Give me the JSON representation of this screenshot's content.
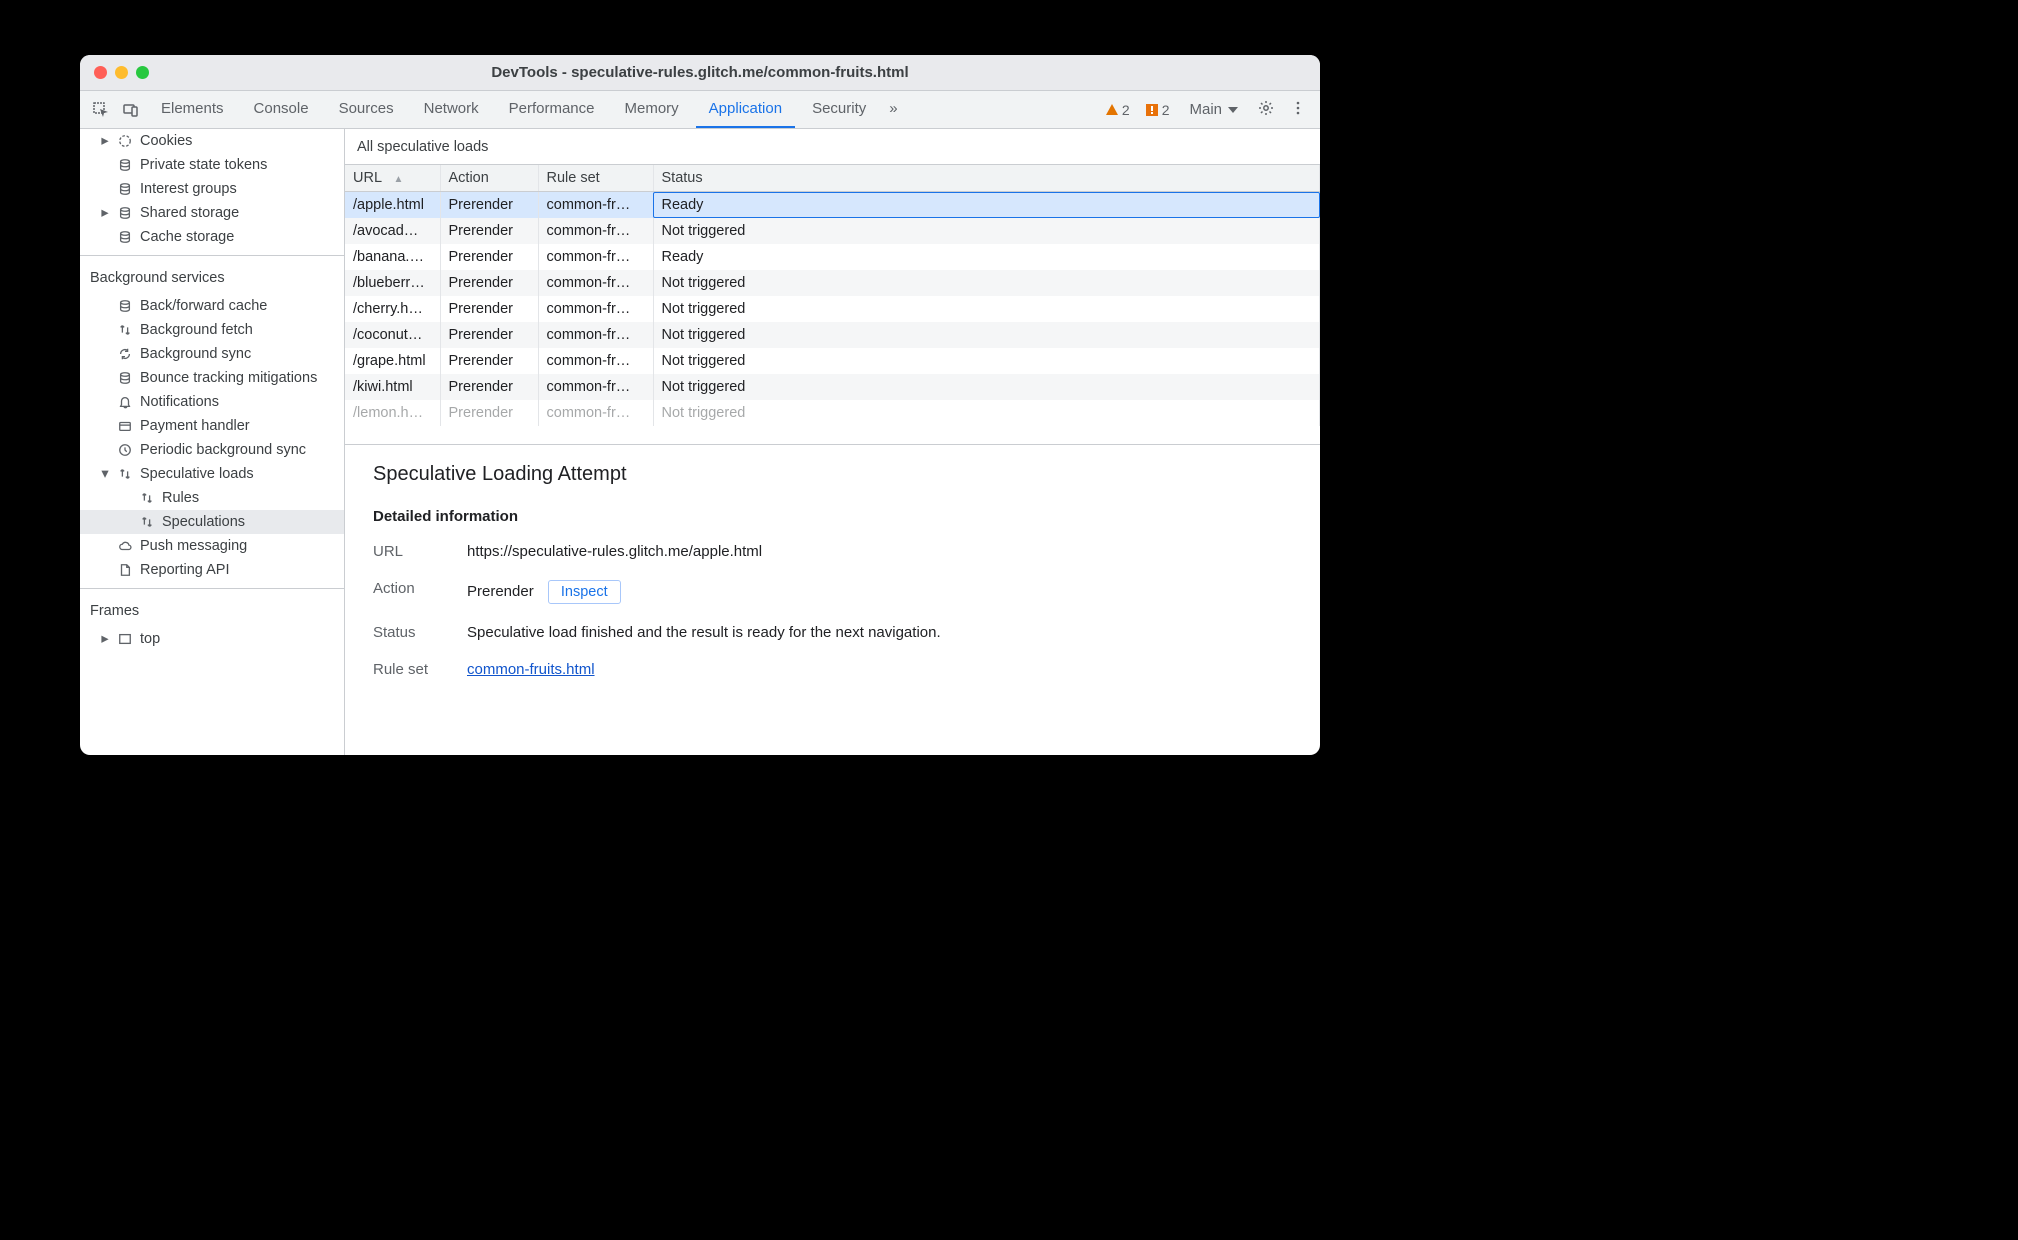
{
  "window": {
    "title": "DevTools - speculative-rules.glitch.me/common-fruits.html"
  },
  "tabs": {
    "items": [
      "Elements",
      "Console",
      "Sources",
      "Network",
      "Performance",
      "Memory",
      "Application",
      "Security"
    ],
    "active": "Application",
    "overflow": "»",
    "warnings_count": "2",
    "issues_count": "2",
    "context": "Main"
  },
  "sidebar": {
    "storage": [
      {
        "label": "Cookies",
        "icon": "cookie",
        "arrow": "collapsed",
        "indent": 1
      },
      {
        "label": "Private state tokens",
        "icon": "db",
        "arrow": "none",
        "indent": 1
      },
      {
        "label": "Interest groups",
        "icon": "db",
        "arrow": "none",
        "indent": 1
      },
      {
        "label": "Shared storage",
        "icon": "db",
        "arrow": "collapsed",
        "indent": 1
      },
      {
        "label": "Cache storage",
        "icon": "db",
        "arrow": "none",
        "indent": 1
      }
    ],
    "bg_title": "Background services",
    "bg": [
      {
        "label": "Back/forward cache",
        "icon": "db",
        "indent": 1
      },
      {
        "label": "Background fetch",
        "icon": "updown",
        "indent": 1
      },
      {
        "label": "Background sync",
        "icon": "sync",
        "indent": 1
      },
      {
        "label": "Bounce tracking mitigations",
        "icon": "db",
        "indent": 1
      },
      {
        "label": "Notifications",
        "icon": "bell",
        "indent": 1
      },
      {
        "label": "Payment handler",
        "icon": "card",
        "indent": 1
      },
      {
        "label": "Periodic background sync",
        "icon": "clock",
        "indent": 1
      }
    ],
    "specloads_label": "Speculative loads",
    "rules_label": "Rules",
    "speculations_label": "Speculations",
    "push_label": "Push messaging",
    "reporting_label": "Reporting API",
    "frames_title": "Frames",
    "frames_top": "top"
  },
  "filter": {
    "label": "All speculative loads"
  },
  "grid": {
    "columns": [
      "URL",
      "Action",
      "Rule set",
      "Status"
    ],
    "rows": [
      {
        "url": "/apple.html",
        "action": "Prerender",
        "ruleset": "common-fr…",
        "status": "Ready",
        "selected": true
      },
      {
        "url": "/avocad…",
        "action": "Prerender",
        "ruleset": "common-fr…",
        "status": "Not triggered"
      },
      {
        "url": "/banana.…",
        "action": "Prerender",
        "ruleset": "common-fr…",
        "status": "Ready"
      },
      {
        "url": "/blueberr…",
        "action": "Prerender",
        "ruleset": "common-fr…",
        "status": "Not triggered"
      },
      {
        "url": "/cherry.h…",
        "action": "Prerender",
        "ruleset": "common-fr…",
        "status": "Not triggered"
      },
      {
        "url": "/coconut…",
        "action": "Prerender",
        "ruleset": "common-fr…",
        "status": "Not triggered"
      },
      {
        "url": "/grape.html",
        "action": "Prerender",
        "ruleset": "common-fr…",
        "status": "Not triggered"
      },
      {
        "url": "/kiwi.html",
        "action": "Prerender",
        "ruleset": "common-fr…",
        "status": "Not triggered"
      },
      {
        "url": "/lemon.h…",
        "action": "Prerender",
        "ruleset": "common-fr…",
        "status": "Not triggered",
        "cut": true
      }
    ]
  },
  "detail": {
    "heading": "Speculative Loading Attempt",
    "section": "Detailed information",
    "url_label": "URL",
    "url_value": "https://speculative-rules.glitch.me/apple.html",
    "action_label": "Action",
    "action_value": "Prerender",
    "inspect": "Inspect",
    "status_label": "Status",
    "status_value": "Speculative load finished and the result is ready for the next navigation.",
    "ruleset_label": "Rule set",
    "ruleset_value": "common-fruits.html"
  }
}
